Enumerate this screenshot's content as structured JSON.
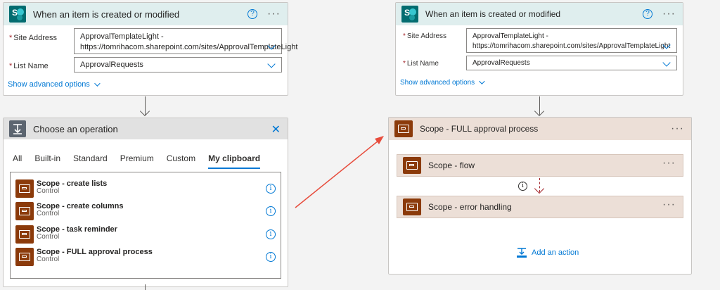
{
  "left": {
    "trigger": {
      "title": "When an item is created or modified",
      "site_label": "Site Address",
      "site_value_line1": "ApprovalTemplateLight -",
      "site_value_line2": "https://tomrihacom.sharepoint.com/sites/ApprovalTemplateLight",
      "list_label": "List Name",
      "list_value": "ApprovalRequests",
      "advanced": "Show advanced options"
    },
    "operation": {
      "title": "Choose an operation",
      "tabs": [
        "All",
        "Built-in",
        "Standard",
        "Premium",
        "Custom",
        "My clipboard"
      ],
      "active_tab": "My clipboard",
      "items": [
        {
          "title": "Scope - create lists",
          "sub": "Control"
        },
        {
          "title": "Scope - create columns",
          "sub": "Control"
        },
        {
          "title": "Scope - task reminder",
          "sub": "Control"
        },
        {
          "title": "Scope - FULL approval process",
          "sub": "Control"
        }
      ]
    }
  },
  "right": {
    "trigger": {
      "title": "When an item is created or modified",
      "site_label": "Site Address",
      "site_value_line1": "ApprovalTemplateLight -",
      "site_value_line2": "https://tomrihacom.sharepoint.com/sites/ApprovalTemplateLight",
      "list_label": "List Name",
      "list_value": "ApprovalRequests",
      "advanced": "Show advanced options"
    },
    "scope": {
      "title": "Scope - FULL approval process",
      "children": [
        {
          "title": "Scope - flow"
        },
        {
          "title": "Scope - error handling"
        }
      ],
      "add_action": "Add an action"
    }
  },
  "icons": {
    "help": "?",
    "info": "i",
    "more": "···",
    "close": "✕",
    "required": "*"
  },
  "colors": {
    "accent": "#0078d4",
    "scope": "#8b3a0a",
    "arrow": "#e74c3c"
  }
}
